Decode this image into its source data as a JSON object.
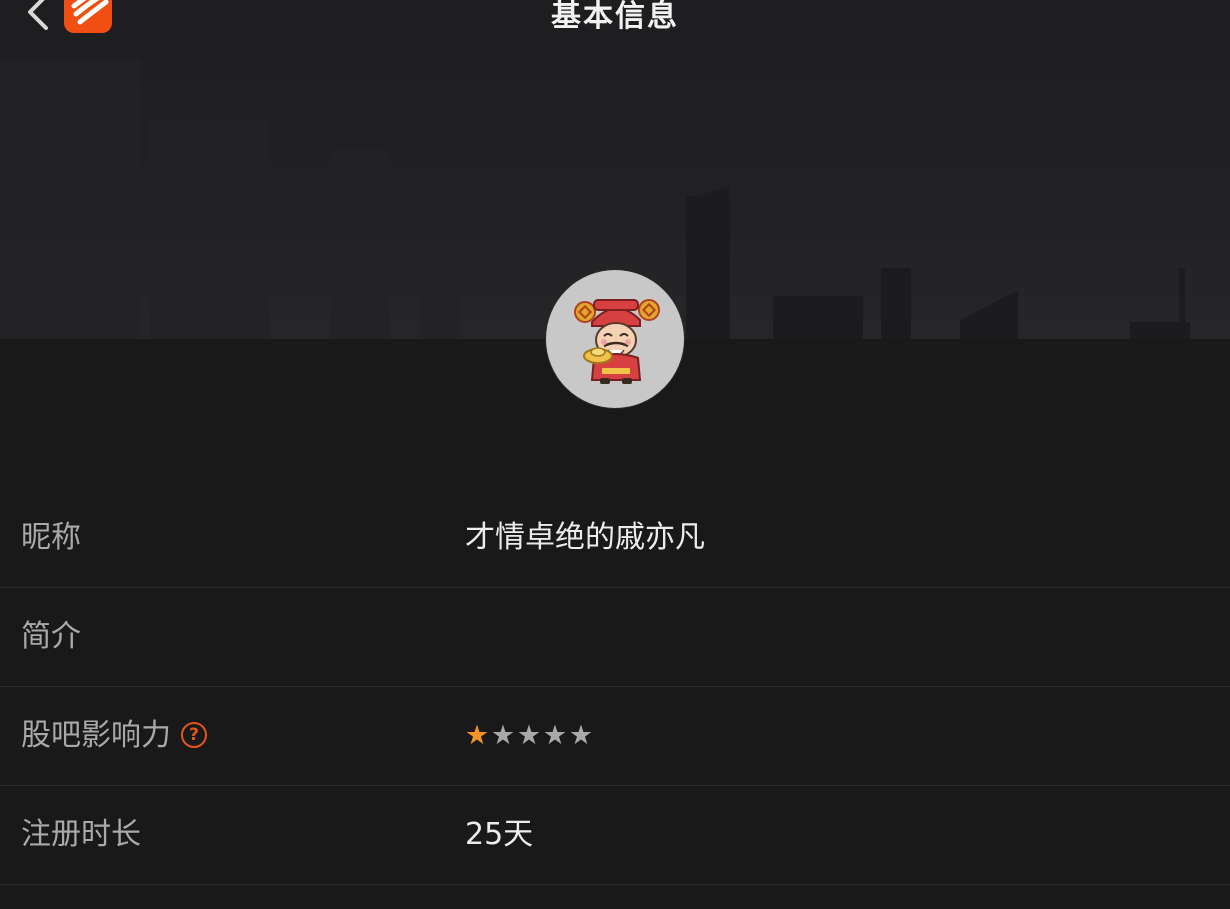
{
  "nav": {
    "title": "基本信息",
    "back_icon": "chevron-left-icon",
    "logo_icon": "app-logo-icon",
    "logo_color": "#f04e12"
  },
  "profile": {
    "avatar_icon": "god-of-wealth-avatar"
  },
  "info": {
    "nickname_label": "昵称",
    "nickname_value": "才情卓绝的戚亦凡",
    "bio_label": "简介",
    "bio_value": "",
    "influence_label": "股吧影响力",
    "influence_help_icon": "question-circle-icon",
    "influence_stars": 1,
    "influence_stars_max": 5,
    "register_label": "注册时长",
    "register_value": "25天"
  },
  "colors": {
    "background": "#191919",
    "accent": "#e5541c",
    "star_active": "#f39424",
    "star_inactive": "#a8a8a8"
  }
}
